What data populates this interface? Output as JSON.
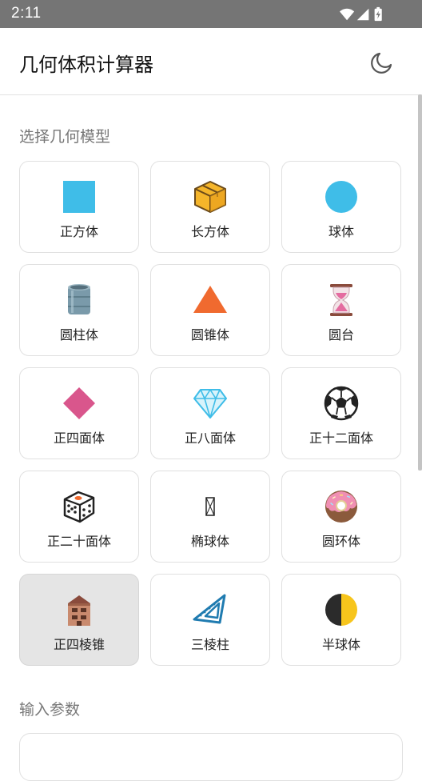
{
  "status_bar": {
    "time": "2:11"
  },
  "app_bar": {
    "title": "几何体积计算器",
    "theme_toggle_icon": "moon-icon"
  },
  "sections": {
    "select_model": "选择几何模型",
    "input_params": "输入参数"
  },
  "models": [
    {
      "label": "正方体",
      "icon": "cube-icon"
    },
    {
      "label": "长方体",
      "icon": "box-icon"
    },
    {
      "label": "球体",
      "icon": "sphere-icon"
    },
    {
      "label": "圆柱体",
      "icon": "cylinder-icon"
    },
    {
      "label": "圆锥体",
      "icon": "cone-icon"
    },
    {
      "label": "圆台",
      "icon": "hourglass-icon"
    },
    {
      "label": "正四面体",
      "icon": "diamond-icon"
    },
    {
      "label": "正八面体",
      "icon": "gem-icon"
    },
    {
      "label": "正十二面体",
      "icon": "soccer-ball-icon"
    },
    {
      "label": "正二十面体",
      "icon": "dice-icon"
    },
    {
      "label": "椭球体",
      "icon": "ellipsoid-icon"
    },
    {
      "label": "圆环体",
      "icon": "donut-icon"
    },
    {
      "label": "正四棱锥",
      "icon": "building-icon",
      "selected": true
    },
    {
      "label": "三棱柱",
      "icon": "triangle-ruler-icon"
    },
    {
      "label": "半球体",
      "icon": "half-circle-icon"
    }
  ],
  "colors": {
    "accent_blue": "#3fbde8",
    "accent_orange": "#f06a2f",
    "accent_pink": "#d9568c",
    "selected_bg": "#e5e5e5"
  }
}
